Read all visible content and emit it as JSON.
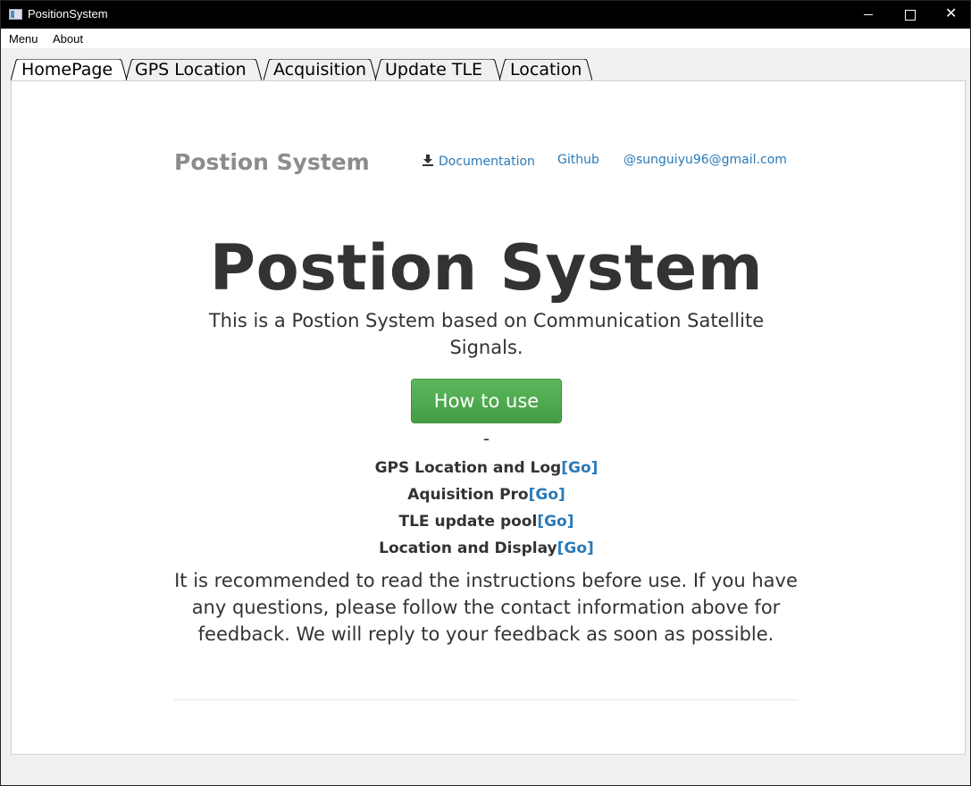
{
  "window": {
    "title": "PositionSystem",
    "controls": {
      "minimize": "minimize",
      "maximize": "maximize",
      "close": "✕"
    }
  },
  "menubar": {
    "items": [
      {
        "label": "Menu"
      },
      {
        "label": "About"
      }
    ]
  },
  "tabs": [
    {
      "label": "HomePage",
      "active": true
    },
    {
      "label": "GPS Location",
      "active": false
    },
    {
      "label": "Acquisition",
      "active": false
    },
    {
      "label": "Update TLE",
      "active": false
    },
    {
      "label": "Location",
      "active": false
    }
  ],
  "page": {
    "nav": {
      "brand": "Postion System",
      "links": [
        {
          "label": "Documentation",
          "icon": "download-icon"
        },
        {
          "label": "Github"
        },
        {
          "label": "@sunguiyu96@gmail.com"
        }
      ]
    },
    "hero": {
      "title": "Postion System",
      "subtitle": "This is a Postion System based on Communication Satellite Signals.",
      "button": "How to use"
    },
    "separator": "-",
    "features": [
      {
        "label": "GPS Location and Log",
        "link": "[Go]"
      },
      {
        "label": "Aquisition Pro",
        "link": "[Go]"
      },
      {
        "label": "TLE update pool",
        "link": "[Go]"
      },
      {
        "label": "Location and Display",
        "link": "[Go]"
      }
    ],
    "note": "It is recommended to read the instructions before use. If you have any questions, please follow the contact information above for feedback. We will reply to your feedback as soon as possible."
  },
  "colors": {
    "titlebar": "#000000",
    "link": "#2a7ab8",
    "button": "#5cb85c",
    "text": "#333333",
    "brand": "#8c8c8c"
  }
}
